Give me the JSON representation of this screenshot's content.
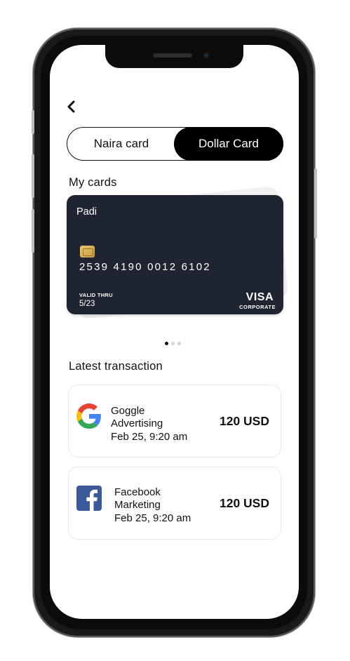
{
  "nav": {
    "back_icon": "chevron-left-icon"
  },
  "toggle": {
    "left_label": "Naira card",
    "right_label": "Dollar Card",
    "selected": "Dollar Card"
  },
  "my_cards": {
    "title": "My cards",
    "card": {
      "holder": "Padi",
      "number": "2539 4190 0012 6102",
      "valid_label": "VALID THRU",
      "valid_value": "5/23",
      "brand": "VISA",
      "brand_sub": "CORPORATE"
    },
    "pagination": {
      "count": 3,
      "active_index": 0
    }
  },
  "transactions": {
    "title": "Latest transaction",
    "items": [
      {
        "name_line1": "Goggle",
        "name_line2": "Advertising",
        "date": "Feb 25, 9:20 am",
        "amount": "120 USD",
        "icon": "google-icon"
      },
      {
        "name_line1": "Facebook",
        "name_line2": "Marketing",
        "date": "Feb 25, 9:20 am",
        "amount": "120 USD",
        "icon": "facebook-icon"
      }
    ]
  },
  "colors": {
    "card_bg": "#1f2530",
    "accent": "#000000",
    "facebook": "#3b5998"
  }
}
